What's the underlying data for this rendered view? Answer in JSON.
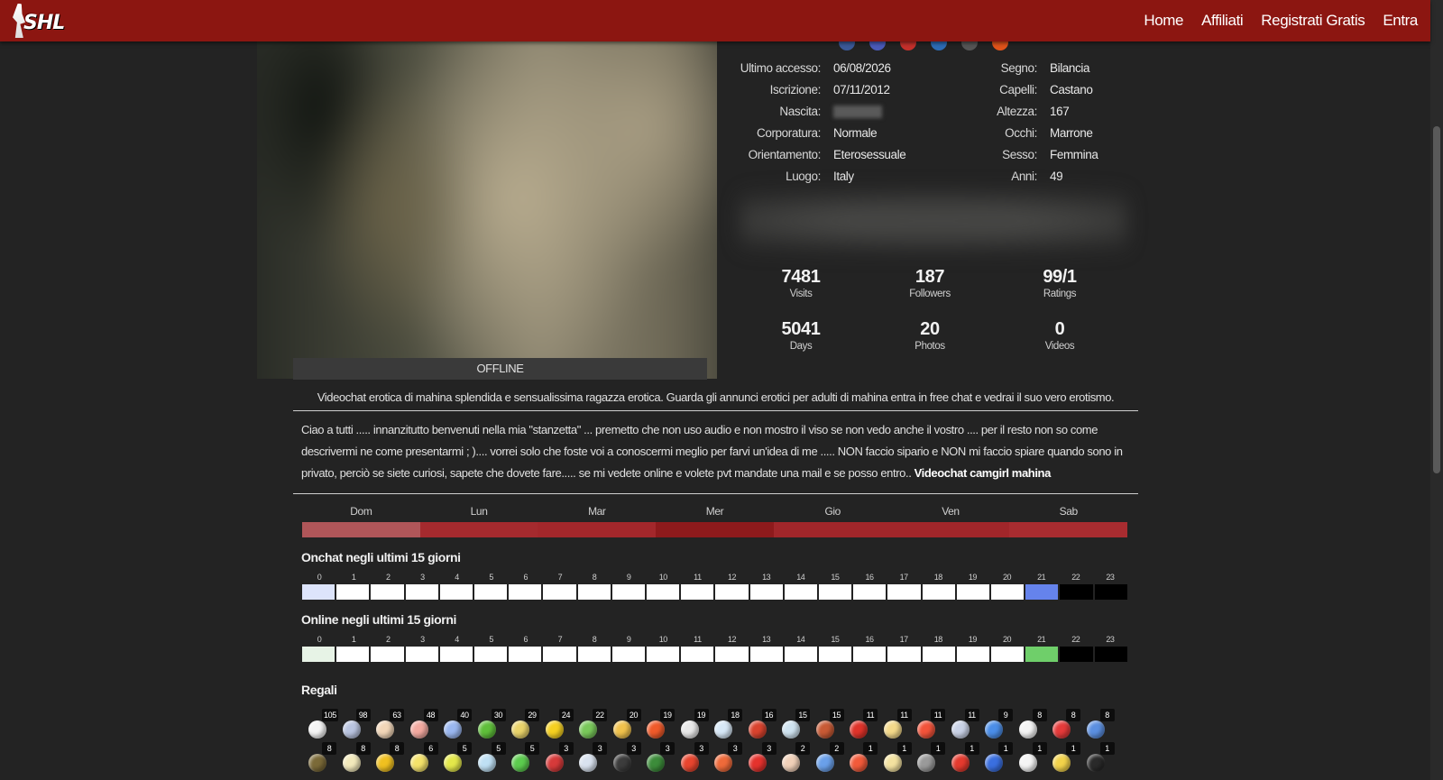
{
  "header": {
    "logo_text": "SHL",
    "nav": [
      "Home",
      "Affiliati",
      "Registrati Gratis",
      "Entra"
    ]
  },
  "profile": {
    "status": "OFFLINE",
    "info_left": [
      {
        "label": "Ultimo accesso:",
        "value": "06/08/2026"
      },
      {
        "label": "Iscrizione:",
        "value": "07/11/2012"
      },
      {
        "label": "Nascita:",
        "value": ""
      },
      {
        "label": "Corporatura:",
        "value": "Normale"
      },
      {
        "label": "Orientamento:",
        "value": "Eterosessuale"
      },
      {
        "label": "Luogo:",
        "value": "Italy"
      }
    ],
    "info_right": [
      {
        "label": "Segno:",
        "value": "Bilancia"
      },
      {
        "label": "Capelli:",
        "value": "Castano"
      },
      {
        "label": "Altezza:",
        "value": "167"
      },
      {
        "label": "Occhi:",
        "value": "Marrone"
      },
      {
        "label": "Sesso:",
        "value": "Femmina"
      },
      {
        "label": "Anni:",
        "value": "49"
      }
    ],
    "stats": [
      {
        "value": "7481",
        "label": "Visits"
      },
      {
        "value": "187",
        "label": "Followers"
      },
      {
        "value": "99/1",
        "label": "Ratings"
      },
      {
        "value": "5041",
        "label": "Days"
      },
      {
        "value": "20",
        "label": "Photos"
      },
      {
        "value": "0",
        "label": "Videos"
      }
    ],
    "description": "Videochat erotica di mahina splendida e sensualissima ragazza erotica. Guarda gli annunci erotici per adulti di mahina entra in free chat e vedrai il suo vero erotismo.",
    "bio": "Ciao a tutti ..... innanzitutto benvenuti nella mia \"stanzetta\" ... premetto che non uso audio e non mostro il viso se non vedo anche il vostro .... per il resto non so come descrivermi ne come presentarmi ; ).... vorrei solo che foste voi a conoscermi meglio per farvi un'idea di me ..... NON faccio sipario e NON mi faccio spiare quando sono in privato, perciò se siete curiosi, sapete che dovete fare..... se mi vedete online e volete pvt mandate una mail e se posso entro..",
    "bio_link": "Videochat camgirl mahina"
  },
  "schedule": {
    "days": [
      "Dom",
      "Lun",
      "Mar",
      "Mer",
      "Gio",
      "Ven",
      "Sab"
    ],
    "day_colors": [
      "#b05659",
      "#a52a2e",
      "#a3272b",
      "#8e1a1c",
      "#a1262a",
      "#a1262a",
      "#a82c30"
    ],
    "onchat_title": "Onchat negli ultimi 15 giorni",
    "online_title": "Online negli ultimi 15 giorni",
    "hours": [
      "0",
      "1",
      "2",
      "3",
      "4",
      "5",
      "6",
      "7",
      "8",
      "9",
      "10",
      "11",
      "12",
      "13",
      "14",
      "15",
      "16",
      "17",
      "18",
      "19",
      "20",
      "21",
      "22",
      "23"
    ],
    "onchat_colors": [
      "#dde4fb",
      "#fff",
      "#fff",
      "#fff",
      "#fff",
      "#fff",
      "#fff",
      "#fff",
      "#fff",
      "#fff",
      "#fff",
      "#fff",
      "#fff",
      "#fff",
      "#fff",
      "#fff",
      "#fff",
      "#fff",
      "#fff",
      "#fff",
      "#fff",
      "#6583ec",
      "#000",
      "#000"
    ],
    "online_colors": [
      "#e7f3e6",
      "#fff",
      "#fff",
      "#fff",
      "#fff",
      "#fff",
      "#fff",
      "#fff",
      "#fff",
      "#fff",
      "#fff",
      "#fff",
      "#fff",
      "#fff",
      "#fff",
      "#fff",
      "#fff",
      "#fff",
      "#fff",
      "#fff",
      "#fff",
      "#6fcf6a",
      "#000",
      "#000"
    ]
  },
  "gifts": {
    "title": "Regali",
    "row1": [
      {
        "icon": "daisy-icon",
        "count": "105",
        "color": "#f4f4f4"
      },
      {
        "icon": "crystal-icon",
        "count": "98",
        "color": "#b9c4e0"
      },
      {
        "icon": "angel-icon",
        "count": "63",
        "color": "#f2d6b8"
      },
      {
        "icon": "piggy-icon",
        "count": "48",
        "color": "#f3a9a0"
      },
      {
        "icon": "wand-icon",
        "count": "40",
        "color": "#9ab7f0"
      },
      {
        "icon": "apple-icon",
        "count": "30",
        "color": "#5fbf3a"
      },
      {
        "icon": "bottle-icon",
        "count": "29",
        "color": "#e9d36a"
      },
      {
        "icon": "sun-icon",
        "count": "24",
        "color": "#f5d020"
      },
      {
        "icon": "potion-icon",
        "count": "22",
        "color": "#79c85a"
      },
      {
        "icon": "beer-icon",
        "count": "20",
        "color": "#f1c24c"
      },
      {
        "icon": "flower-icon",
        "count": "19",
        "color": "#f05a2a"
      },
      {
        "icon": "cocktail-icon",
        "count": "19",
        "color": "#e8e8e8"
      },
      {
        "icon": "medkit-icon",
        "count": "18",
        "color": "#d7e8f7"
      },
      {
        "icon": "lipstick-icon",
        "count": "16",
        "color": "#d9432e"
      },
      {
        "icon": "globe-icon",
        "count": "15",
        "color": "#cfe3f0"
      },
      {
        "icon": "oscar-icon",
        "count": "15",
        "color": "#c85a35"
      },
      {
        "icon": "tomato-icon",
        "count": "11",
        "color": "#e0332a"
      },
      {
        "icon": "icecream-icon",
        "count": "11",
        "color": "#f4d98a"
      },
      {
        "icon": "heart-icon",
        "count": "11",
        "color": "#f2533a"
      },
      {
        "icon": "bowling-icon",
        "count": "11",
        "color": "#c9d2e6"
      },
      {
        "icon": "medal-icon",
        "count": "9",
        "color": "#4b8ee8"
      },
      {
        "icon": "card-icon",
        "count": "8",
        "color": "#f4f4f4"
      },
      {
        "icon": "wine-icon",
        "count": "8",
        "color": "#e63a3a"
      },
      {
        "icon": "dice-icon",
        "count": "8",
        "color": "#5b8fe0"
      }
    ],
    "row2": [
      {
        "icon": "bag-icon",
        "count": "8",
        "color": "#7b6a38"
      },
      {
        "icon": "goblet-icon",
        "count": "8",
        "color": "#f2e9bb"
      },
      {
        "icon": "bell-icon",
        "count": "8",
        "color": "#f0c020"
      },
      {
        "icon": "sparkle-icon",
        "count": "6",
        "color": "#f4e26a"
      },
      {
        "icon": "flask-icon",
        "count": "5",
        "color": "#e4e84a"
      },
      {
        "icon": "ice-icon",
        "count": "5",
        "color": "#bfe0f4"
      },
      {
        "icon": "pill-icon",
        "count": "5",
        "color": "#5ccc4e"
      },
      {
        "icon": "magnet-icon",
        "count": "3",
        "color": "#d63a3a"
      },
      {
        "icon": "car-icon",
        "count": "3",
        "color": "#d9e2ef"
      },
      {
        "icon": "tophat-icon",
        "count": "3",
        "color": "#3c3c3c"
      },
      {
        "icon": "champagne-icon",
        "count": "3",
        "color": "#3c8c3a"
      },
      {
        "icon": "clock-icon",
        "count": "3",
        "color": "#e8452e"
      },
      {
        "icon": "lab-flask-icon",
        "count": "3",
        "color": "#ef6a3a"
      },
      {
        "icon": "boxing-icon",
        "count": "3",
        "color": "#e5322d"
      },
      {
        "icon": "doctor-icon",
        "count": "2",
        "color": "#f0d0b8"
      },
      {
        "icon": "vial-icon",
        "count": "2",
        "color": "#6aa0ea"
      },
      {
        "icon": "lifebuoy-icon",
        "count": "1",
        "color": "#f25a3a"
      },
      {
        "icon": "torch-icon",
        "count": "1",
        "color": "#f3e2a0"
      },
      {
        "icon": "gun-icon",
        "count": "1",
        "color": "#9a9a9a"
      },
      {
        "icon": "capsule-red-icon",
        "count": "1",
        "color": "#e53a2e"
      },
      {
        "icon": "capsule-blue-icon",
        "count": "1",
        "color": "#3a6fe0"
      },
      {
        "icon": "cloud-icon",
        "count": "1",
        "color": "#f4f4f4"
      },
      {
        "icon": "capsule-yellow-icon",
        "count": "1",
        "color": "#f2d24a"
      },
      {
        "icon": "bomb-icon",
        "count": "1",
        "color": "#2a2a2a"
      }
    ]
  }
}
